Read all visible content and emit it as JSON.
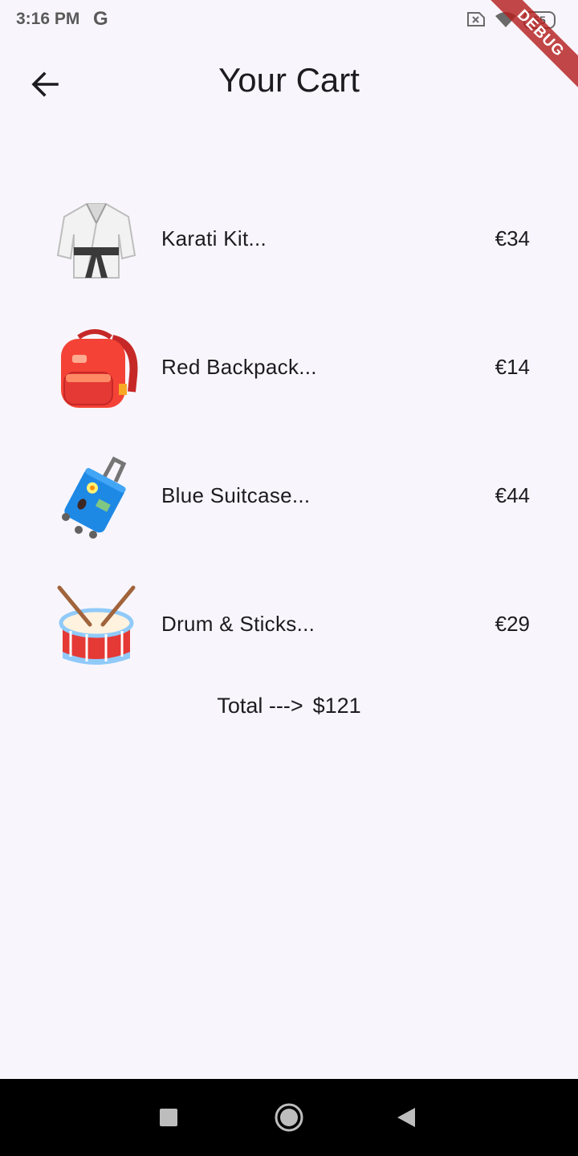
{
  "status_bar": {
    "time": "3:16 PM",
    "google_glyph": "G",
    "battery_level": "55",
    "debug_label": "DEBUG",
    "icons": [
      "google-icon",
      "no-sim-icon",
      "wifi-icon",
      "battery-icon"
    ]
  },
  "app_bar": {
    "title": "Your Cart",
    "back_icon": "arrow-back-icon"
  },
  "cart": {
    "items": [
      {
        "name": "Karati Kit...",
        "price": "€34",
        "image": "karate-uniform-icon"
      },
      {
        "name": "Red Backpack...",
        "price": "€14",
        "image": "backpack-icon"
      },
      {
        "name": "Blue Suitcase...",
        "price": "€44",
        "image": "suitcase-icon"
      },
      {
        "name": "Drum & Sticks...",
        "price": "€29",
        "image": "drum-icon"
      }
    ],
    "total_label": "Total --->",
    "total_amount": "$121"
  },
  "nav_bar": {
    "icons": [
      "recents-square-icon",
      "home-circle-icon",
      "back-triangle-icon"
    ]
  },
  "colors": {
    "background": "#f8f6fc",
    "text": "#1c1b1f",
    "debug_ribbon": "#b41e1e",
    "nav_bar": "#000000"
  }
}
